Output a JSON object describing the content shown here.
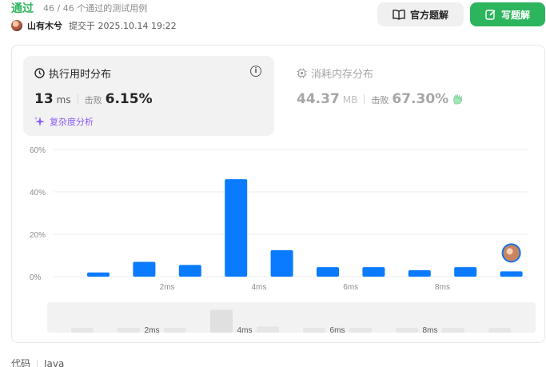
{
  "header": {
    "status": "通过",
    "testcases": "46 / 46 个通过的测试用例",
    "author": "山有木兮",
    "submit_time": "提交于 2025.10.14 19:22",
    "btn_official": "官方题解",
    "btn_write": "写题解"
  },
  "runtime": {
    "title": "执行用时分布",
    "value": "13",
    "unit": "ms",
    "beats_label": "击败",
    "beats": "6.15%",
    "complexity": "复杂度分析"
  },
  "memory": {
    "title": "消耗内存分布",
    "value": "44.37",
    "unit": "MB",
    "beats_label": "击败",
    "beats": "67.30%"
  },
  "chart_data": {
    "type": "bar",
    "title": "",
    "ylim": [
      0,
      60
    ],
    "yticks": [
      "0%",
      "20%",
      "40%",
      "60%"
    ],
    "xtick_labels": [
      "2ms",
      "4ms",
      "6ms",
      "8ms"
    ],
    "series": [
      {
        "values": [
          2,
          7,
          5.5,
          46,
          12.5,
          4.5,
          4.5,
          3,
          4.5,
          2.5
        ]
      }
    ],
    "highlight_index": 9,
    "colors": {
      "bar": "#0a7aff",
      "grid": "#ececec"
    }
  },
  "mini_overview": {
    "labels": [
      "2ms",
      "4ms",
      "6ms",
      "8ms"
    ]
  },
  "code": {
    "label": "代码",
    "language": "Java"
  }
}
